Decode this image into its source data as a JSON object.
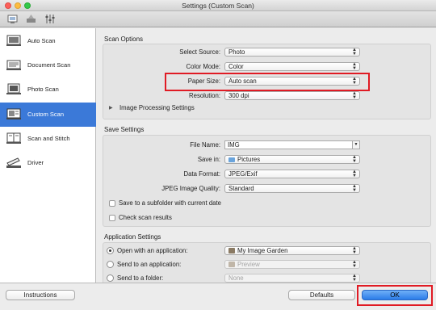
{
  "window": {
    "title": "Settings (Custom Scan)"
  },
  "toolbar": {
    "icons": [
      "scan-from-computer-icon",
      "scan-from-operation-panel-icon",
      "general-settings-icon"
    ]
  },
  "sidebar": {
    "items": [
      {
        "label": "Auto Scan",
        "icon": "auto-scan-icon",
        "selected": false
      },
      {
        "label": "Document Scan",
        "icon": "document-scan-icon",
        "selected": false
      },
      {
        "label": "Photo Scan",
        "icon": "photo-scan-icon",
        "selected": false
      },
      {
        "label": "Custom Scan",
        "icon": "custom-scan-icon",
        "selected": true
      },
      {
        "label": "Scan and Stitch",
        "icon": "scan-and-stitch-icon",
        "selected": false
      },
      {
        "label": "Driver",
        "icon": "driver-icon",
        "selected": false
      }
    ]
  },
  "scan_options": {
    "title": "Scan Options",
    "select_source": {
      "label": "Select Source:",
      "value": "Photo"
    },
    "color_mode": {
      "label": "Color Mode:",
      "value": "Color"
    },
    "paper_size": {
      "label": "Paper Size:",
      "value": "Auto scan"
    },
    "resolution": {
      "label": "Resolution:",
      "value": "300 dpi"
    },
    "image_processing": {
      "label": "Image Processing Settings"
    }
  },
  "save_settings": {
    "title": "Save Settings",
    "file_name": {
      "label": "File Name:",
      "value": "IMG"
    },
    "save_in": {
      "label": "Save in:",
      "value": "Pictures"
    },
    "data_format": {
      "label": "Data Format:",
      "value": "JPEG/Exif"
    },
    "jpeg_quality": {
      "label": "JPEG Image Quality:",
      "value": "Standard"
    },
    "subfolder": {
      "label": "Save to a subfolder with current date",
      "checked": false
    },
    "check_results": {
      "label": "Check scan results",
      "checked": false
    }
  },
  "application_settings": {
    "title": "Application Settings",
    "open_with": {
      "label": "Open with an application:",
      "value": "My Image Garden",
      "selected": true
    },
    "send_to_app": {
      "label": "Send to an application:",
      "value": "Preview",
      "selected": false
    },
    "send_to_folder": {
      "label": "Send to a folder:",
      "value": "None",
      "selected": false
    }
  },
  "buttons": {
    "instructions": "Instructions",
    "defaults": "Defaults",
    "ok": "OK"
  },
  "colors": {
    "accent": "#3b79d8",
    "highlight": "#e01b24",
    "ok_button": "#2b7ce8"
  }
}
